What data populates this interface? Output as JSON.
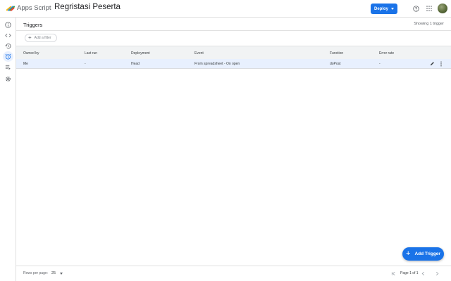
{
  "header": {
    "app_name": "Apps Script",
    "project_title": "Regristasi Peserta",
    "deploy_label": "Deploy"
  },
  "sidebar": {
    "items": [
      {
        "icon": "info-icon",
        "label": "Overview"
      },
      {
        "icon": "code-icon",
        "label": "Editor"
      },
      {
        "icon": "history-icon",
        "label": "Executions"
      },
      {
        "icon": "alarm-icon",
        "label": "Triggers",
        "active": true
      },
      {
        "icon": "queue-list-icon",
        "label": "Executions list"
      },
      {
        "icon": "settings-icon",
        "label": "Project Settings"
      }
    ]
  },
  "page": {
    "title": "Triggers",
    "showing": "Showing 1 trigger",
    "filter_placeholder": "Add a filter"
  },
  "table": {
    "columns": [
      "Owned by",
      "Last run",
      "Deployment",
      "Event",
      "Function",
      "Error rate"
    ],
    "rows": [
      {
        "owned_by": "Me",
        "last_run": "-",
        "deployment": "Head",
        "event": "From spreadsheet - On open",
        "function": "doPost",
        "error_rate": "-"
      }
    ]
  },
  "fab": {
    "label": "Add Trigger"
  },
  "footer": {
    "rows_per_page_label": "Rows per page:",
    "rows_per_page_value": "25",
    "page_label": "Page 1 of 1"
  },
  "colors": {
    "accent": "#1a73e8",
    "selected_row": "#e8f0fe",
    "header_bg": "#f1f3f4"
  }
}
